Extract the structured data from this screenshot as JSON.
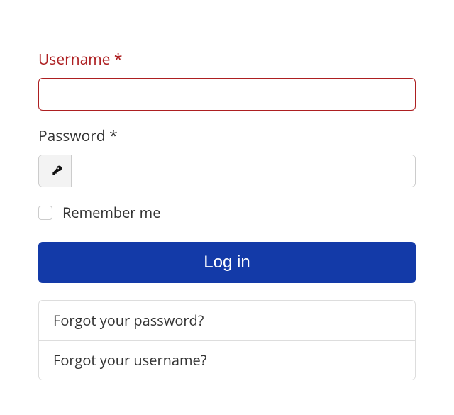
{
  "form": {
    "username": {
      "label": "Username *",
      "value": ""
    },
    "password": {
      "label": "Password *",
      "value": ""
    },
    "remember": {
      "label": "Remember me",
      "checked": false
    },
    "submit": {
      "label": "Log in"
    }
  },
  "links": {
    "forgot_password": "Forgot your password?",
    "forgot_username": "Forgot your username?"
  },
  "colors": {
    "primary": "#133aa8",
    "error": "#ad1f21"
  }
}
